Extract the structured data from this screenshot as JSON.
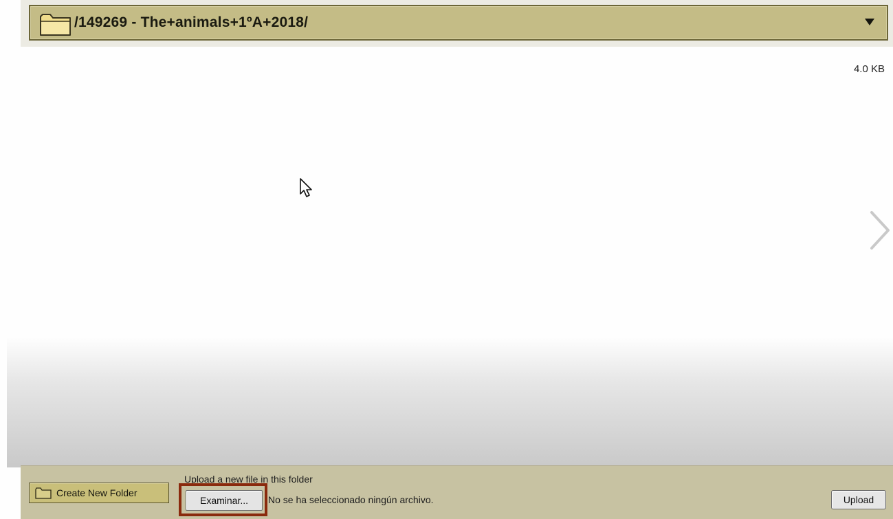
{
  "header": {
    "path": "/149269 - The+animals+1ºA+2018/",
    "folder_icon": "folder-icon",
    "dropdown_icon": "dropdown-arrow-icon",
    "colors": {
      "bar": "#c4bc86",
      "border": "#6c6638"
    }
  },
  "file_info": {
    "size": "4.0 KB"
  },
  "navigation": {
    "next_icon": "chevron-right-icon"
  },
  "footer": {
    "create_folder_label": "Create New Folder",
    "upload_heading": "Upload a new file in this folder",
    "browse_label": "Examinar...",
    "no_file_text": "No se ha seleccionado ningún archivo.",
    "upload_label": "Upload",
    "highlight_color": "#8a2a0d"
  }
}
